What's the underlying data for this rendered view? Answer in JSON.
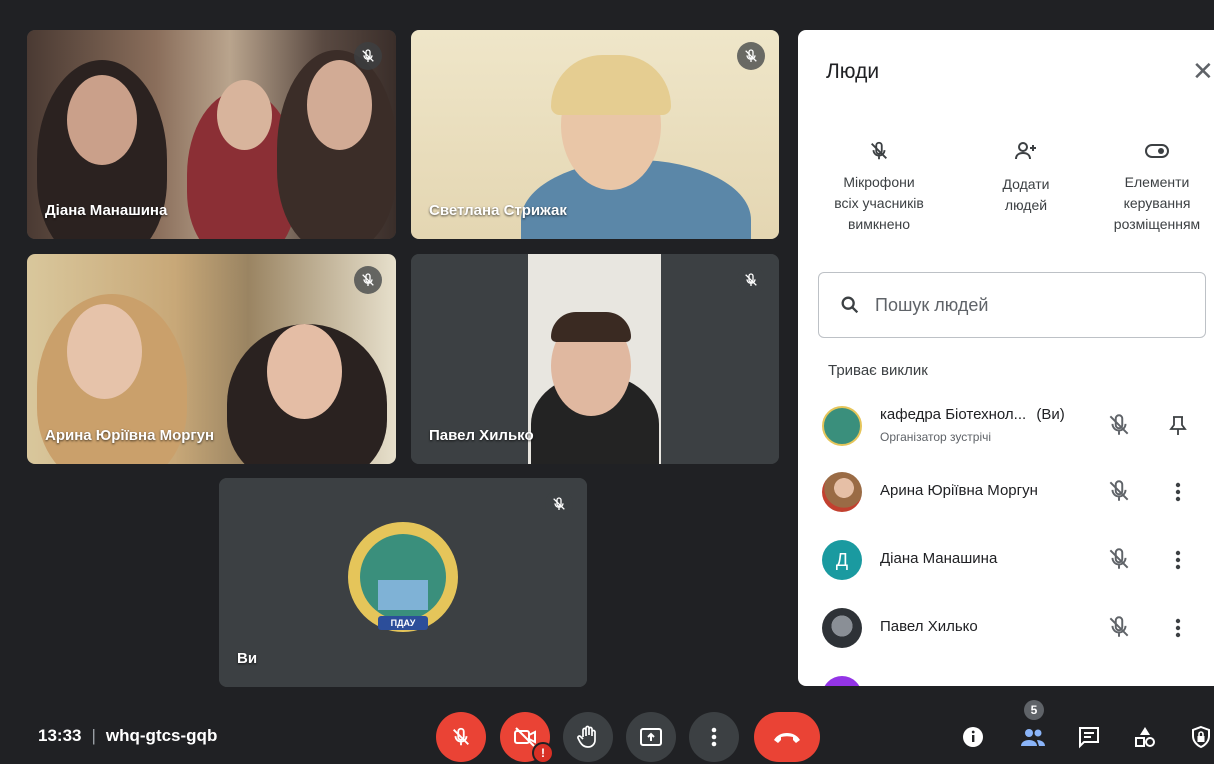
{
  "tiles": [
    {
      "name": "Діана Манашина"
    },
    {
      "name": "Светлана Стрижак"
    },
    {
      "name": "Арина Юріївна Моргун"
    },
    {
      "name": "Павел Хилько"
    },
    {
      "name": "Ви",
      "logo_text": "ПДАУ"
    }
  ],
  "panel": {
    "title": "Люди",
    "actions": [
      {
        "label_lines": [
          "Мікрофони",
          "всіх учасників",
          "вимкнено"
        ]
      },
      {
        "label_lines": [
          "Додати",
          "людей"
        ]
      },
      {
        "label_lines": [
          "Елементи",
          "керування",
          "розміщенням"
        ]
      }
    ],
    "search_placeholder": "Пошук людей",
    "section": "Триває виклик",
    "participants": [
      {
        "name": "кафедра Біотехнол...",
        "you": "(Ви)",
        "role": "Організатор зустрічі",
        "avatar": "logo"
      },
      {
        "name": "Арина Юріївна Моргун",
        "avatar": "photo"
      },
      {
        "name": "Діана Манашина",
        "avatar_letter": "Д",
        "avatar_color": "#1a9aa0"
      },
      {
        "name": "Павел Хилько",
        "avatar": "photo"
      }
    ]
  },
  "bottom_bar": {
    "time": "13:33",
    "separator": "|",
    "meeting_code": "whq-gtcs-gqb",
    "people_count": "5"
  },
  "colors": {
    "accent_red": "#ea4335",
    "bar_bg": "#202124",
    "people_blue": "#8ab4f8"
  }
}
